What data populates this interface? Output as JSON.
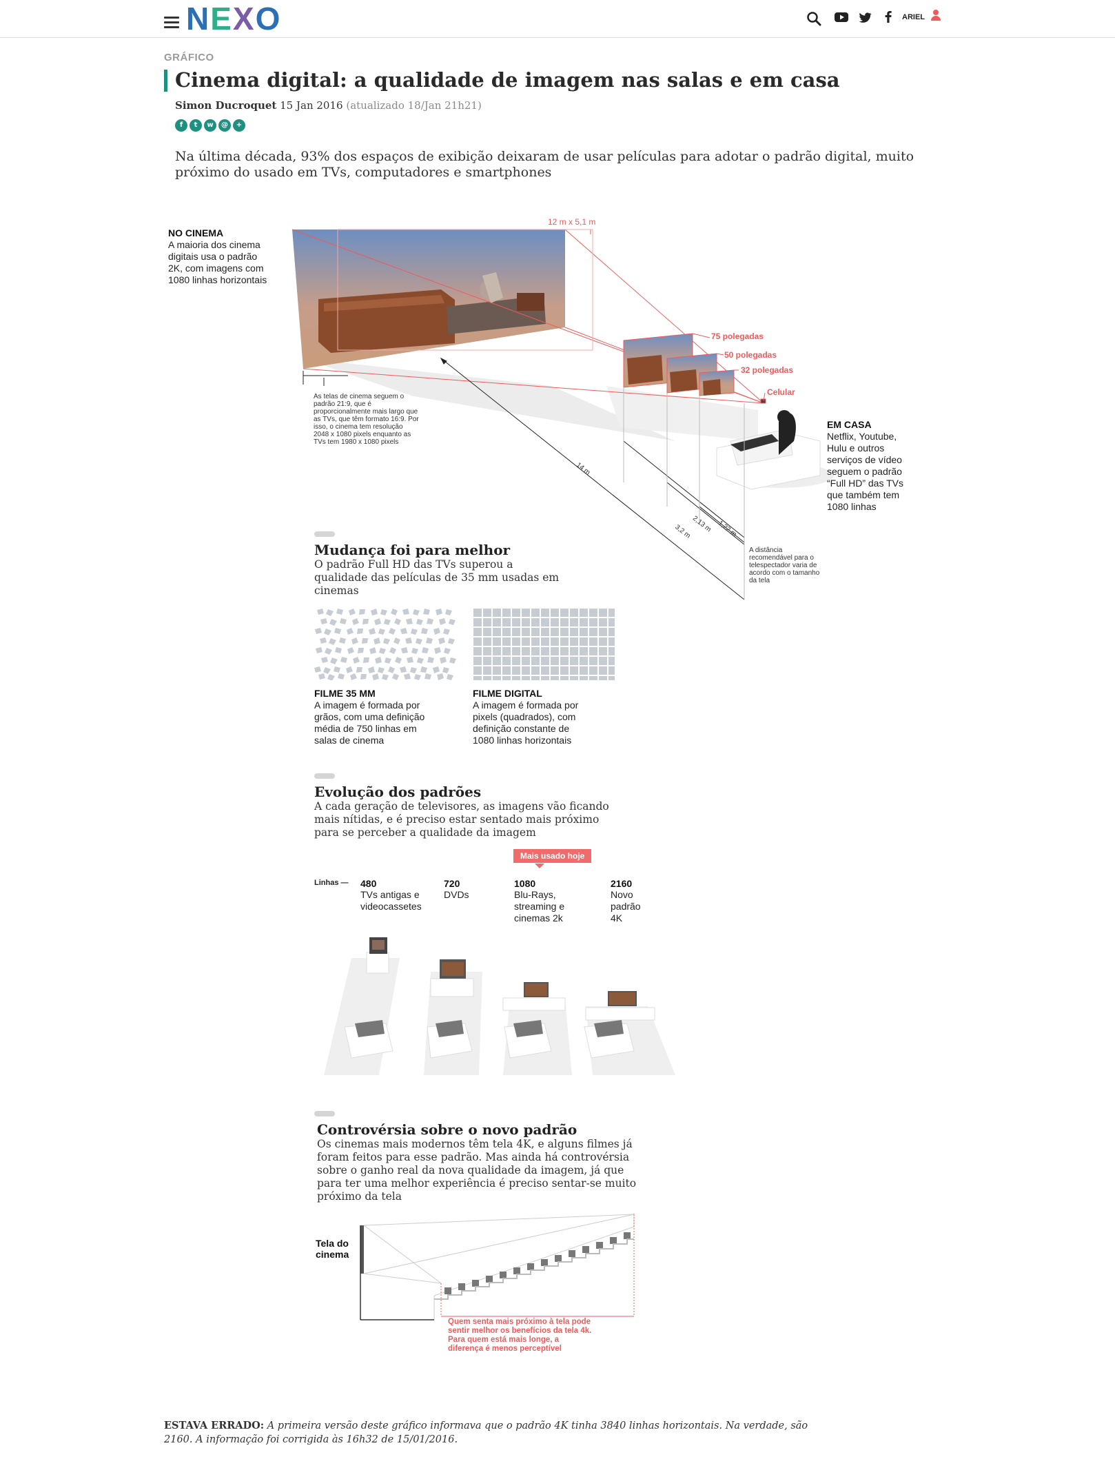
{
  "header": {
    "logo": "NEXO",
    "user_label": "ARIEL"
  },
  "article": {
    "kicker": "GRÁFICO",
    "title": "Cinema digital: a qualidade de imagem nas salas e em casa",
    "author": "Simon Ducroquet",
    "date": "15 Jan 2016",
    "updated": "(atualizado 18/Jan 21h21)",
    "lede": "Na última década, 93% dos espaços de exibição deixaram de usar películas para adotar o padrão digital, muito próximo do usado em TVs, computadores e smartphones"
  },
  "share_icons": [
    "facebook-icon",
    "twitter-icon",
    "whatsapp-icon",
    "email-icon",
    "plus-icon"
  ],
  "graphic1": {
    "cinema_title": "NO CINEMA",
    "cinema_text": [
      "A maioria dos cinema",
      "digitais usa o padrão",
      "2K, com imagens com",
      "1080 linhas horizontais"
    ],
    "screen_size": "12 m x 5,1 m",
    "tv75": "75 polegadas",
    "tv50": "50 polegadas",
    "tv32": "32 polegadas",
    "phone": "Celular",
    "ratio_note": [
      "As telas de cinema seguem o",
      "padrão 21:9, que é",
      "proporcionalmente mais largo que",
      "as TVs, que têm formato 16:9. Por",
      "isso, o cinema tem resolução",
      "2048 x 1080 pixels enquanto as",
      "TVs tem 1980 x 1080 pixels"
    ],
    "home_title": "EM CASA",
    "home_text": [
      "Netflix, Youtube,",
      "Hulu e outros",
      "serviços de vídeo",
      "seguem o padrão",
      "“Full HD” das TVs",
      "que também tem",
      "1080 linhas"
    ],
    "dist_14": "14 m",
    "dist_32": "3,2 m",
    "dist_213": "2,13 m",
    "dist_122": "1,22 m",
    "dist_note": [
      "A distância",
      "recomendável para o",
      "telespectador varia de",
      "acordo com o tamanho",
      "da tela"
    ]
  },
  "section1": {
    "heading": "Mudança foi para melhor",
    "text": "O padrão Full HD das TVs superou a qualidade das películas de 35 mm usadas em cinemas",
    "film_title": "FILME 35 MM",
    "film_text": [
      "A imagem é formada por",
      "grãos, com uma definição",
      "média de 750 linhas em",
      "salas de cinema"
    ],
    "digital_title": "FILME DIGITAL",
    "digital_text": [
      "A imagem é formada por",
      "pixels (quadrados), com",
      "definição constante de",
      "1080 linhas horizontais"
    ]
  },
  "section2": {
    "heading": "Evolução dos padrões",
    "text": "A cada geração de televisores, as imagens vão ficando mais nítidas, e é preciso estar sentado mais próximo para se perceber a qualidade da imagem",
    "badge": "Mais usado hoje",
    "lines_label": "Linhas",
    "standards": [
      {
        "lines": "480",
        "desc": [
          "TVs antigas e",
          "videocassetes"
        ]
      },
      {
        "lines": "720",
        "desc": [
          "DVDs"
        ]
      },
      {
        "lines": "1080",
        "desc": [
          "Blu-Rays,",
          "streaming e",
          "cinemas 2k"
        ]
      },
      {
        "lines": "2160",
        "desc": [
          "Novo",
          "padrão",
          "4K"
        ]
      }
    ]
  },
  "section3": {
    "heading": "Controvérsia sobre o novo padrão",
    "text": "Os cinemas mais modernos têm tela 4K, e alguns filmes já foram feitos para esse padrão. Mas ainda há controvérsia sobre o ganho real da nova qualidade da imagem, já que para ter uma melhor experiência é preciso sentar-se muito próximo da tela",
    "screen_label": [
      "Tela do",
      "cinema"
    ],
    "red_note": [
      "Quem senta mais próximo à tela pode",
      "sentir melhor os benefícios da tela 4k.",
      "Para quem está mais longe, a",
      "diferença é menos perceptível"
    ]
  },
  "correction": {
    "label": "ESTAVA ERRADO:",
    "text": "A primeira versão deste gráfico informava que o padrão 4K tinha 3840 linhas horizontais. Na verdade, são 2160. A informação foi corrigida às 16h32 de 15/01/2016."
  },
  "colors": {
    "accent": "#1f8f7f",
    "red": "#f05a5a",
    "logo_blue": "#2b6fb5",
    "logo_green": "#2fae8a",
    "logo_purple": "#7b5ca8"
  }
}
